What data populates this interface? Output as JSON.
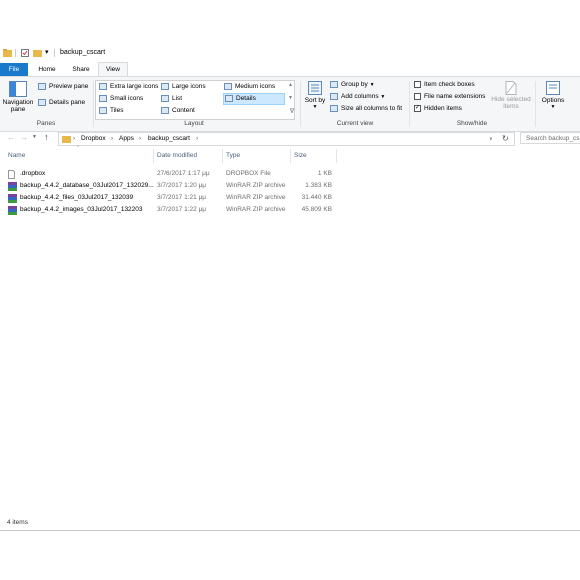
{
  "window": {
    "title": "backup_cscart"
  },
  "tabs": [
    {
      "label": "File"
    },
    {
      "label": "Home"
    },
    {
      "label": "Share"
    },
    {
      "label": "View"
    }
  ],
  "ribbon": {
    "panes": {
      "navigation_pane": "Navigation pane",
      "preview_pane": "Preview pane",
      "details_pane": "Details pane",
      "group_label": "Panes"
    },
    "layout": {
      "extra_large_icons": "Extra large icons",
      "large_icons": "Large icons",
      "medium_icons": "Medium icons",
      "small_icons": "Small icons",
      "list": "List",
      "details": "Details",
      "tiles": "Tiles",
      "content": "Content",
      "group_label": "Layout"
    },
    "current_view": {
      "sort_by": "Sort by",
      "group_by": "Group by",
      "add_columns": "Add columns",
      "size_all_columns": "Size all columns to fit",
      "group_label": "Current view"
    },
    "show_hide": {
      "item_check_boxes": "Item check boxes",
      "file_name_extensions": "File name extensions",
      "hidden_items": "Hidden items",
      "hide_selected": "Hide selected items",
      "group_label": "Show/hide"
    },
    "options": "Options"
  },
  "address": {
    "crumbs": [
      "Dropbox",
      "Apps",
      "backup_cscart"
    ],
    "search_placeholder": "Search backup_cs"
  },
  "columns": {
    "name": "Name",
    "date": "Date modified",
    "type": "Type",
    "size": "Size"
  },
  "files": [
    {
      "name": ".dropbox",
      "date": "27/6/2017 1:17 μμ",
      "type": "DROPBOX File",
      "size": "1 KB",
      "icon": "file-icon"
    },
    {
      "name": "backup_4.4.2_database_03Jul2017_132029...",
      "date": "3/7/2017 1:20 μμ",
      "type": "WinRAR ZIP archive",
      "size": "1.383 KB",
      "icon": "winrar-icon"
    },
    {
      "name": "backup_4.4.2_files_03Jul2017_132039",
      "date": "3/7/2017 1:21 μμ",
      "type": "WinRAR ZIP archive",
      "size": "31.440 KB",
      "icon": "winrar-icon"
    },
    {
      "name": "backup_4.4.2_images_03Jul2017_132203",
      "date": "3/7/2017 1:22 μμ",
      "type": "WinRAR ZIP archive",
      "size": "45.809 KB",
      "icon": "winrar-icon"
    }
  ],
  "status": {
    "item_count": "4 items"
  },
  "colors": {
    "accent": "#1979ca",
    "selection": "#cce8ff",
    "folder": "#e8b84a"
  }
}
